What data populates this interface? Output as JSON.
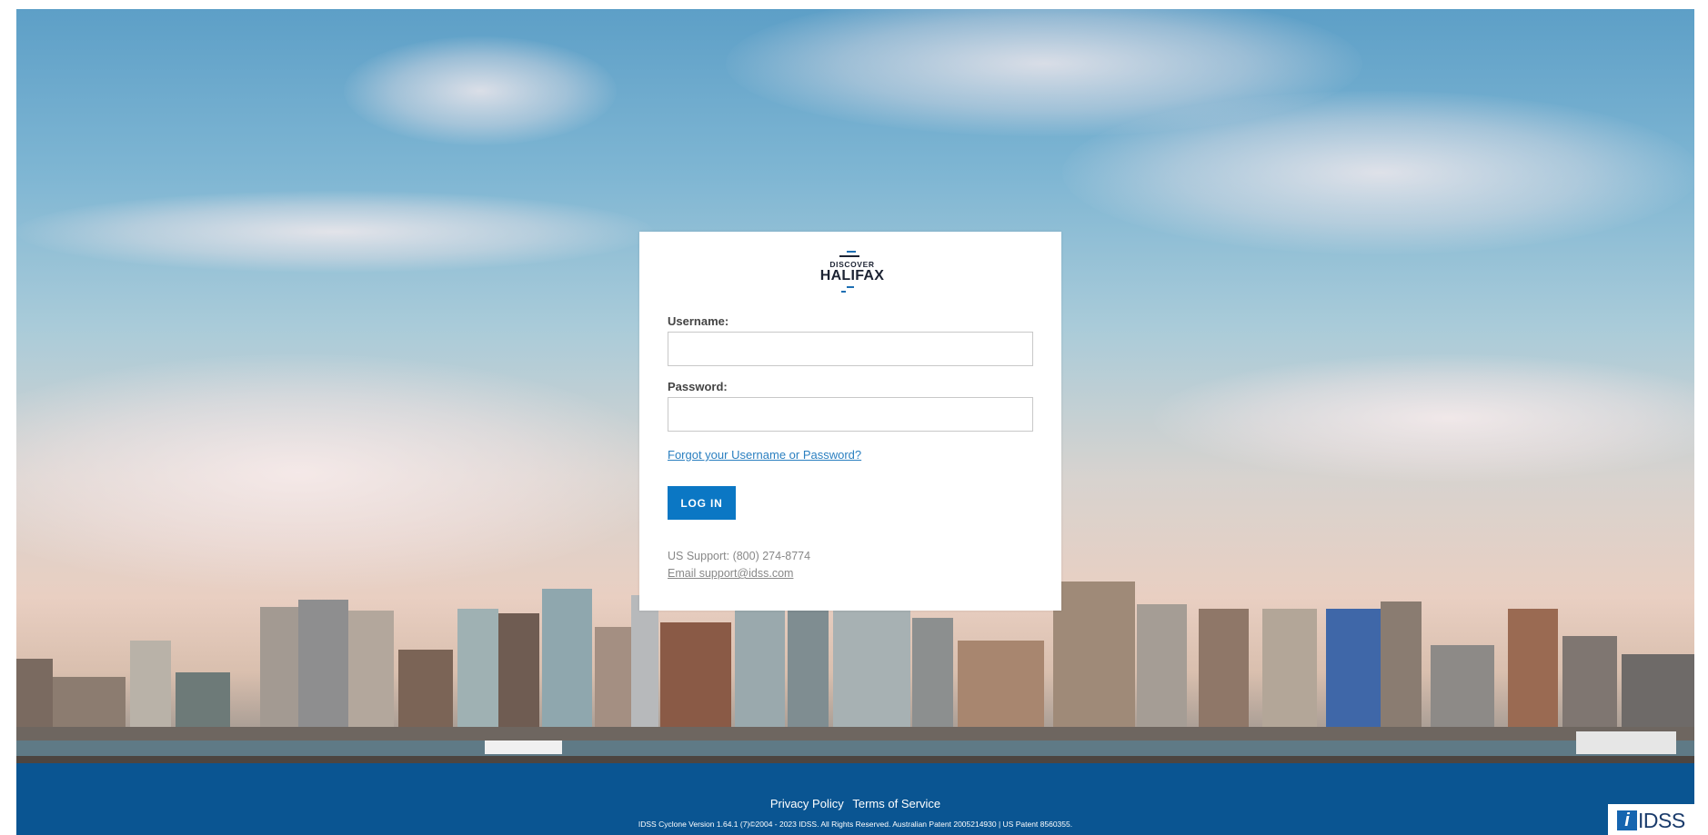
{
  "logo": {
    "line1": "DISCOVER",
    "line2": "HALIFAX"
  },
  "login": {
    "username_label": "Username:",
    "username_value": "",
    "password_label": "Password:",
    "password_value": "",
    "forgot_link": "Forgot your Username or Password?",
    "login_button": "LOG IN",
    "support_phone": "US Support: (800) 274-8774",
    "support_email": "Email support@idss.com"
  },
  "footer": {
    "privacy_policy": "Privacy Policy",
    "terms_of_service": "Terms of Service",
    "copyright": "IDSS Cyclone Version 1.64.1 (7)©2004 - 2023 IDSS. All Rights Reserved. Australian Patent 2005214930 | US Patent 8560355.",
    "badge_mark": "i",
    "badge_text": "IDSS"
  },
  "colors": {
    "primary_button": "#0b77c4",
    "footer_bg": "#0a5592",
    "link": "#2a7fc0"
  }
}
